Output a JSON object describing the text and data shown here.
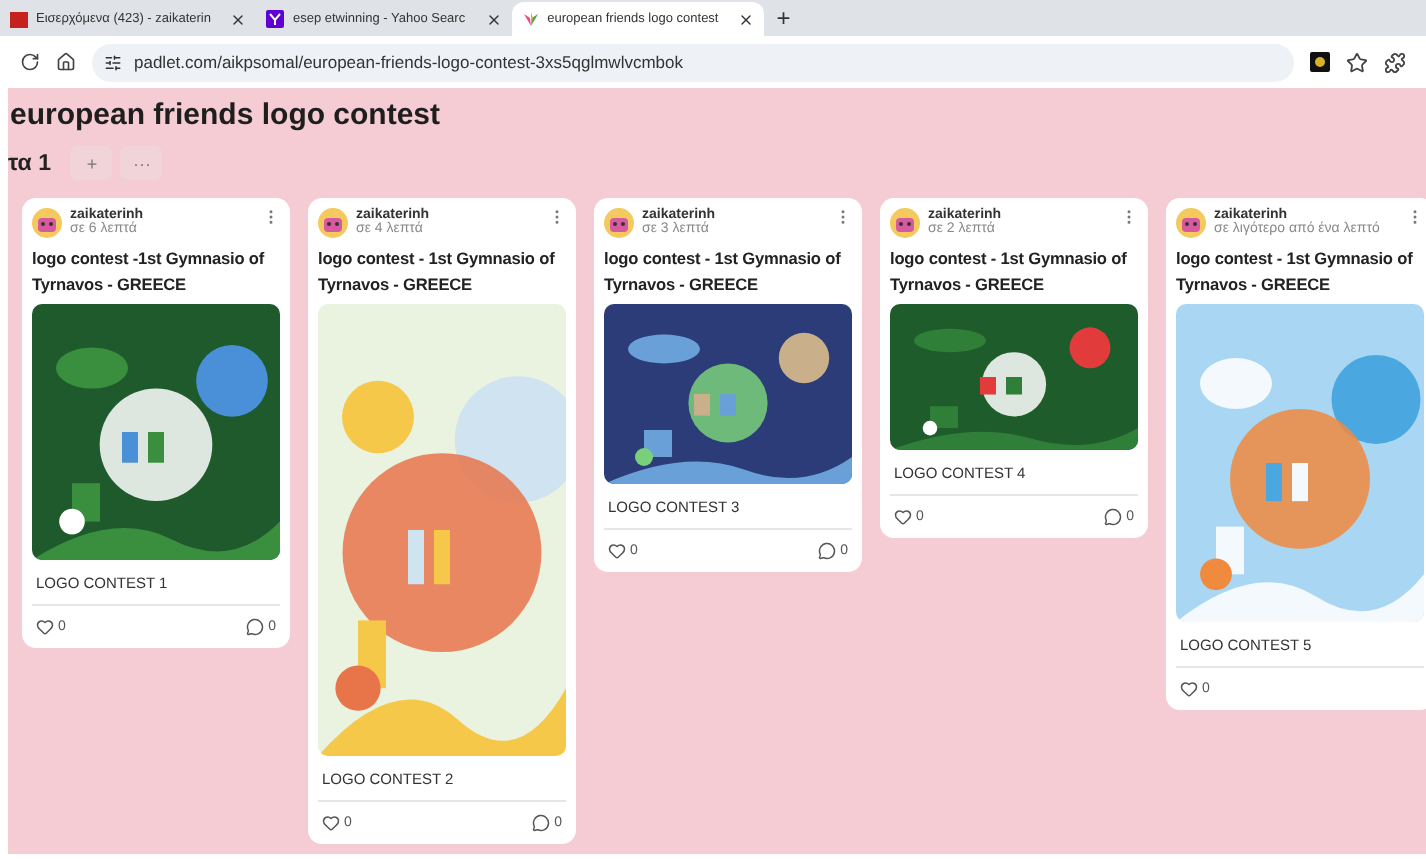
{
  "browser": {
    "tabs": [
      {
        "title": "Εισερχόμενα (423) - zaikaterin",
        "selected": false
      },
      {
        "title": "esep etwinning - Yahoo Searc",
        "selected": false
      },
      {
        "title": "european friends logo contest",
        "selected": true
      }
    ],
    "new_tab": "+",
    "url": "padlet.com/aikpsomal/european-friends-logo-contest-3xs5qglmwlvcmbok"
  },
  "board": {
    "title": "european friends logo contest",
    "section": {
      "label": "τα 1",
      "add": "+",
      "more": "···"
    },
    "posts": [
      {
        "author": "zaikaterinh",
        "time": "σε 6 λεπτά",
        "title": "logo contest -1st Gymnasio of Tyrnavos - GREECE",
        "caption": "LOGO CONTEST 1",
        "likes": "0",
        "comments": "0"
      },
      {
        "author": "zaikaterinh",
        "time": "σε 4 λεπτά",
        "title": "logo contest - 1st Gymnasio of Tyrnavos - GREECE",
        "caption": "LOGO CONTEST 2",
        "likes": "0",
        "comments": "0"
      },
      {
        "author": "zaikaterinh",
        "time": "σε 3 λεπτά",
        "title": "logo contest - 1st Gymnasio of Tyrnavos - GREECE",
        "caption": "LOGO CONTEST 3",
        "likes": "0",
        "comments": "0"
      },
      {
        "author": "zaikaterinh",
        "time": "σε 2 λεπτά",
        "title": "logo contest - 1st Gymnasio of Tyrnavos - GREECE",
        "caption": "LOGO CONTEST 4",
        "likes": "0",
        "comments": "0"
      },
      {
        "author": "zaikaterinh",
        "time": "σε λιγότερο από ένα λεπτό",
        "title": "logo contest - 1st Gymnasio of Tyrnavos - GREECE",
        "caption": "LOGO CONTEST 5",
        "likes": "0"
      }
    ]
  }
}
